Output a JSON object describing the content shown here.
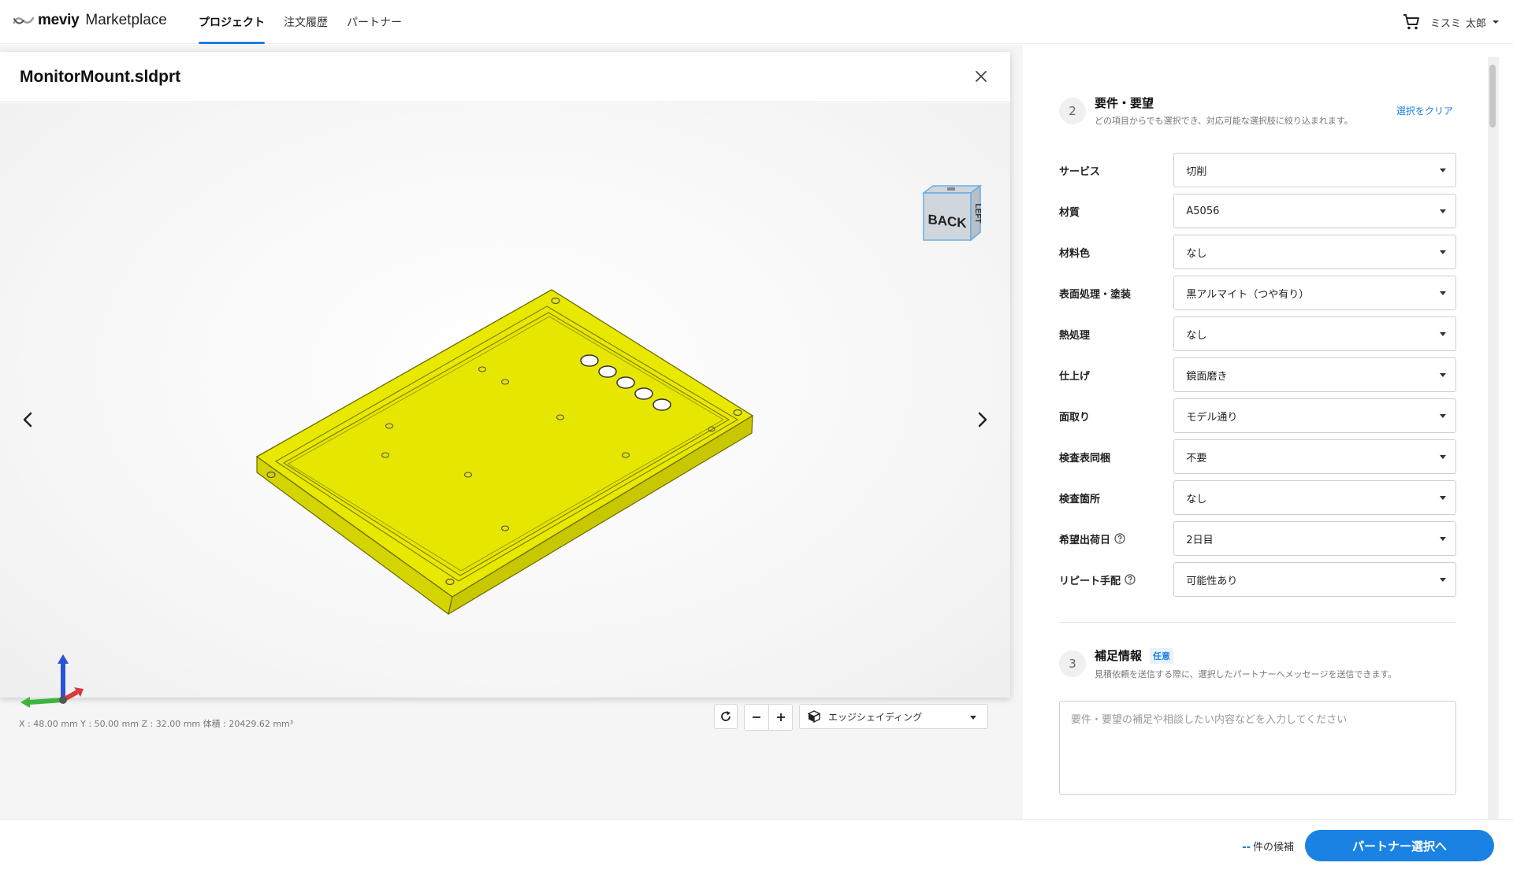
{
  "header": {
    "logo_brand": "meviy",
    "logo_product": "Marketplace",
    "tabs": [
      {
        "label": "プロジェクト",
        "active": true
      },
      {
        "label": "注文履歴",
        "active": false
      },
      {
        "label": "パートナー",
        "active": false
      }
    ],
    "user": {
      "company": "ミスミ",
      "name": "太郎"
    },
    "cart_icon": "cart-icon"
  },
  "viewer": {
    "title": "MonitorMount.sldprt",
    "close_icon": "close-icon",
    "view_cube": {
      "front": "BACK",
      "side": "LEFT"
    },
    "dims": "X : 48.00 mm   Y : 50.00 mm   Z : 32.00 mm   体積 : 20429.62 mm³",
    "model_color": "#e8e800",
    "shading_mode": "エッジシェイディング"
  },
  "requirements": {
    "step": "2",
    "title": "要件・要望",
    "description": "どの項目からでも選択でき、対応可能な選択肢に絞り込まれます。",
    "clear_label": "選択をクリア",
    "fields": [
      {
        "label": "サービス",
        "value": "切削",
        "help": false
      },
      {
        "label": "材質",
        "value": "A5056",
        "help": false
      },
      {
        "label": "材料色",
        "value": "なし",
        "help": false
      },
      {
        "label": "表面処理・塗装",
        "value": "黒アルマイト（つや有り）",
        "help": false
      },
      {
        "label": "熱処理",
        "value": "なし",
        "help": false
      },
      {
        "label": "仕上げ",
        "value": "鏡面磨き",
        "help": false
      },
      {
        "label": "面取り",
        "value": "モデル通り",
        "help": false
      },
      {
        "label": "検査表同梱",
        "value": "不要",
        "help": false
      },
      {
        "label": "検査箇所",
        "value": "なし",
        "help": false
      },
      {
        "label": "希望出荷日",
        "value": "2日目",
        "help": true
      },
      {
        "label": "リピート手配",
        "value": "可能性あり",
        "help": true
      }
    ]
  },
  "supplement": {
    "step": "3",
    "title": "補足情報",
    "optional_badge": "任意",
    "description": "見積依頼を送信する際に、選択したパートナーへメッセージを送信できます。",
    "placeholder": "要件・要望の補足や相談したい内容などを入力してください"
  },
  "footer": {
    "count": "--",
    "count_suffix": "件の候補",
    "next_button": "パートナー選択へ"
  },
  "colors": {
    "accent": "#1a82e2",
    "model": "#e8e800"
  }
}
